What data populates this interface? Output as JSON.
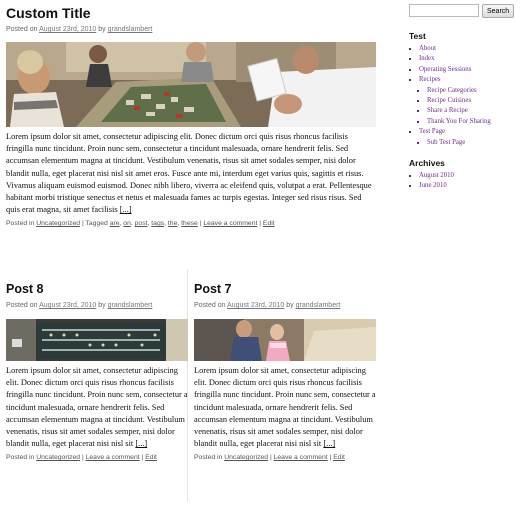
{
  "main_post": {
    "title": "Custom Title",
    "meta_prefix": "Posted on",
    "date": "August 23rd, 2010",
    "by": "by",
    "author": "grandslambert",
    "body": "Lorem ipsum dolor sit amet, consectetur adipiscing elit. Donec dictum orci quis risus rhoncus facilisis fringilla nunc tincidunt. Proin nunc sem, consectetur a tincidunt malesuada, ornare hendrerit felis. Sed accumsan elementum magna at tincidunt. Vestibulum venenatis, risus sit amet sodales semper, nisi dolor blandit nulla, eget placerat nisi nisl sit amet eros. Fusce ante mi, interdum eget varius quis, sagittis et risus. Vivamus aliquam euismod euismod. Donec nibh libero, viverra ac eleifend quis, volutpat a erat. Pellentesque habitant morbi tristique senectus et netus et malesuada fames ac turpis egestas. Integer sed risus risus. Sed quis erat magna, sit amet facilisis",
    "more": "[...]",
    "posted_in": "Posted in",
    "category": "Uncategorized",
    "tagged": "| Tagged",
    "tags": [
      "are",
      "on",
      "post",
      "tags",
      "the",
      "these"
    ],
    "comment": "Leave a comment",
    "edit": "Edit",
    "sep": "|"
  },
  "posts": [
    {
      "title": "Post 8",
      "meta_prefix": "Posted on",
      "date": "August 23rd, 2010",
      "by": "by",
      "author": "grandslambert",
      "body": "Lorem ipsum dolor sit amet, consectetur adipiscing elit. Donec dictum orci quis risus rhoncus facilisis fringilla nunc tincidunt. Proin nunc sem, consectetur a tincidunt malesuada, ornare hendrerit felis. Sed accumsan elementum magna at tincidunt. Vestibulum venenatis, risus sit amet sodales semper, nisi dolor blandit nulla, eget placerat nisi nisl sit",
      "more": "[...]",
      "posted_in": "Posted in",
      "category": "Uncategorized",
      "comment": "Leave a comment",
      "edit": "Edit",
      "sep": "|"
    },
    {
      "title": "Post 7",
      "meta_prefix": "Posted on",
      "date": "August 23rd, 2010",
      "by": "by",
      "author": "grandslambert",
      "body": "Lorem ipsum dolor sit amet, consectetur adipiscing elit. Donec dictum orci quis risus rhoncus facilisis fringilla nunc tincidunt. Proin nunc sem, consectetur a tincidunt malesuada, ornare hendrerit felis. Sed accumsan elementum magna at tincidunt. Vestibulum venenatis, risus sit amet sodales semper, nisi dolor blandit nulla, eget placerat nisi nisl sit",
      "more": "[...]",
      "posted_in": "Posted in",
      "category": "Uncategorized",
      "comment": "Leave a comment",
      "edit": "Edit",
      "sep": "|"
    }
  ],
  "sidebar": {
    "search_button": "Search",
    "search_value": "",
    "test_title": "Test",
    "pages": {
      "about": "About",
      "index": "Index",
      "operating": "Operating Sessions",
      "recipes": "Recipes",
      "recipe_categories": "Recipe Categories",
      "recipe_cuisines": "Recipe Cuisines",
      "share_recipe": "Share a Recipe",
      "thank_you": "Thank You For Sharing",
      "test_page": "Test Page",
      "sub_test_page": "Sub Test Page"
    },
    "archives_title": "Archives",
    "archives": [
      "August 2010",
      "June 2010"
    ]
  },
  "colors": {
    "link": "#6b2e8a",
    "text": "#111111",
    "meta": "#666666"
  }
}
